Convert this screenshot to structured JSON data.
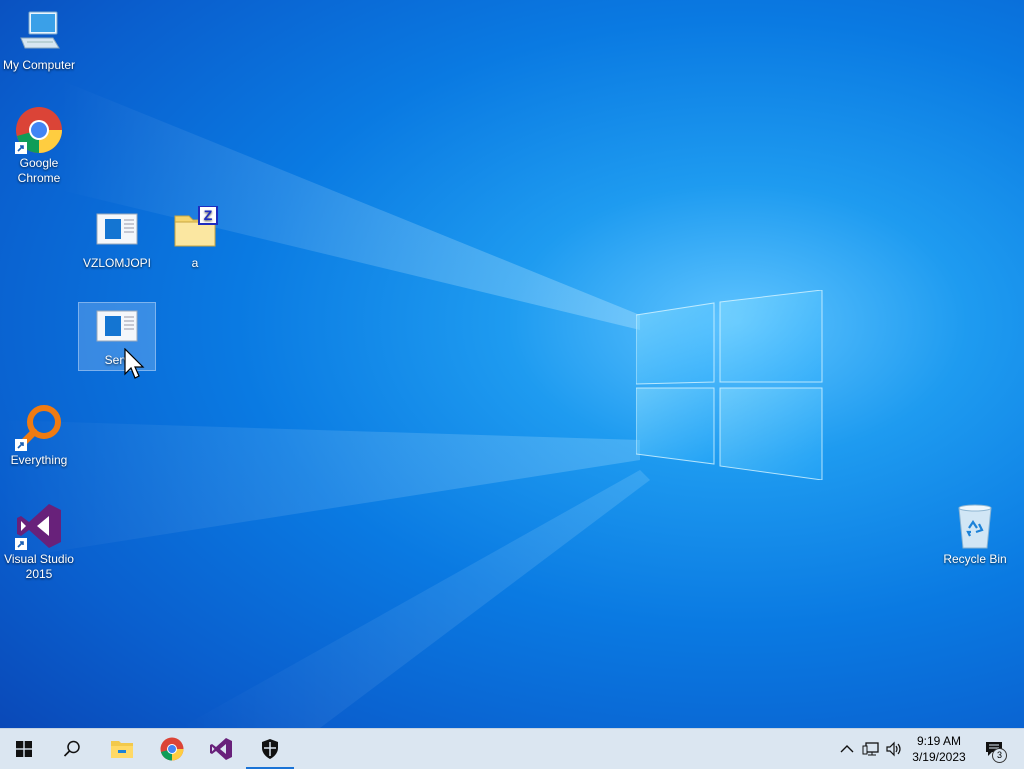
{
  "desktop": {
    "icons": [
      {
        "id": "my-computer",
        "label": "My Computer"
      },
      {
        "id": "google-chrome",
        "label": "Google\nChrome"
      },
      {
        "id": "vzlomjopi",
        "label": "VZLOMJOPI"
      },
      {
        "id": "a",
        "label": "a"
      },
      {
        "id": "server",
        "label": "Serv"
      },
      {
        "id": "everything",
        "label": "Everything"
      },
      {
        "id": "visual-studio",
        "label": "Visual Studio\n2015"
      },
      {
        "id": "recycle-bin",
        "label": "Recycle Bin"
      }
    ],
    "selected_icon": "server"
  },
  "taskbar": {
    "apps": [
      "start-icon",
      "search-icon",
      "file-explorer-icon",
      "chrome-icon",
      "visual-studio-icon",
      "security-shield-icon"
    ],
    "active_app": "security-shield-icon",
    "clock": {
      "time": "9:19 AM",
      "date": "3/19/2023"
    },
    "notifications": {
      "count": "3"
    }
  },
  "colors": {
    "accent": "#1a73d6",
    "taskbar": "#dbe6f1"
  }
}
